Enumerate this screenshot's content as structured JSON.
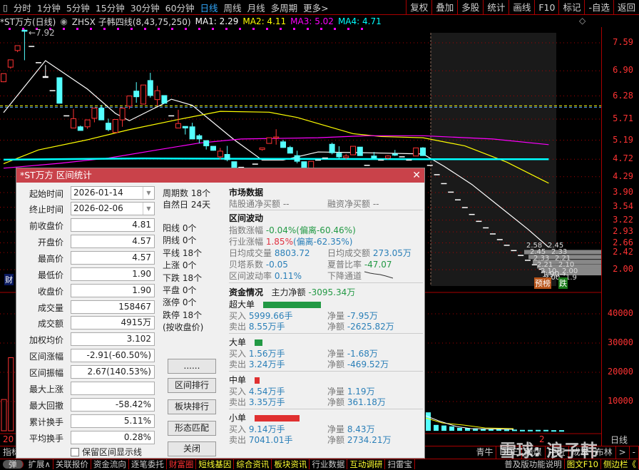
{
  "toolbar": {
    "periods": [
      "分时",
      "1分钟",
      "5分钟",
      "15分钟",
      "30分钟",
      "60分钟",
      "日线",
      "周线",
      "月线",
      "多周期",
      "更多>"
    ],
    "active": "日线",
    "right_buttons": [
      "复权",
      "叠加",
      "多股",
      "统计",
      "画线",
      "F10",
      "标记",
      "-自选",
      "返回"
    ]
  },
  "legend": {
    "title": "*ST万方(日线)",
    "indicator": "ZHSX 子韩四线(8,43,75,250)",
    "ma1": "MA1: 2.29",
    "ma2": "MA2: 4.11",
    "ma3": "MA3: 5.02",
    "ma4": "MA4: 4.71",
    "colors": {
      "ma1": "#ffffff",
      "ma2": "#ffff00",
      "ma3": "#ff00ff",
      "ma4": "#00ffff"
    }
  },
  "chart_data": {
    "type": "candlestick",
    "price_ticks": [
      "7.59",
      "6.90",
      "6.28",
      "5.71",
      "5.19",
      "4.72",
      "4.29",
      "3.90",
      "3.54",
      "3.22",
      "2.93",
      "2.66",
      "2.42",
      "2.00"
    ],
    "high_label": "7.92",
    "low_label": "1.90",
    "candles": [
      [
        6.63,
        6.83,
        6.62,
        6.83
      ],
      [
        6.99,
        7.17,
        6.95,
        7.17
      ],
      [
        7.4,
        7.52,
        7.36,
        7.52
      ],
      [
        7.9,
        7.92,
        7.16,
        7.88
      ],
      [
        7.5,
        7.5,
        7.5,
        7.5
      ],
      [
        7.1,
        7.1,
        7.1,
        7.1
      ],
      [
        6.76,
        7.04,
        6.76,
        6.76
      ],
      [
        6.41,
        6.41,
        6.41,
        6.41
      ],
      [
        6.73,
        6.73,
        6.1,
        6.1
      ],
      [
        5.79,
        5.79,
        5.79,
        5.79
      ],
      [
        5.49,
        5.96,
        5.49,
        5.72
      ],
      [
        5.52,
        5.55,
        5.43,
        5.43
      ],
      [
        5.52,
        5.69,
        5.47,
        5.69
      ],
      [
        5.73,
        5.98,
        5.63,
        5.98
      ],
      [
        5.98,
        6.06,
        5.69,
        5.69
      ],
      [
        5.61,
        5.72,
        5.41,
        5.45
      ],
      [
        5.38,
        5.7,
        5.38,
        5.7
      ],
      [
        5.69,
        5.98,
        5.52,
        5.98
      ],
      [
        6.03,
        6.28,
        5.96,
        6.28
      ],
      [
        6.4,
        6.62,
        6.11,
        6.26
      ],
      [
        6.08,
        6.55,
        6.08,
        6.55
      ],
      [
        6.66,
        6.85,
        6.24,
        6.29
      ],
      [
        6.19,
        6.53,
        6.04,
        6.41
      ],
      [
        6.29,
        6.29,
        6.1,
        6.1
      ],
      [
        5.79,
        5.79,
        5.79,
        5.79
      ],
      [
        5.49,
        5.94,
        5.49,
        5.6
      ],
      [
        5.53,
        5.53,
        5.33,
        5.49
      ],
      [
        5.52,
        5.62,
        5.22,
        5.22
      ],
      [
        5.3,
        5.34,
        5.11,
        5.22
      ],
      [
        5.18,
        5.18,
        4.96,
        5.05
      ],
      [
        5.04,
        5.04,
        4.93,
        4.94
      ],
      [
        4.78,
        5.0,
        4.71,
        4.92
      ],
      [
        4.84,
        5.05,
        4.67,
        4.71
      ],
      [
        4.66,
        4.66,
        4.46,
        4.46
      ],
      [
        4.52,
        4.52,
        4.52,
        4.52
      ],
      [
        4.45,
        4.45,
        4.45,
        4.45
      ],
      [
        4.6,
        4.6,
        4.6,
        4.6
      ],
      [
        4.96,
        5.0,
        4.93,
        5.0
      ],
      [
        5.11,
        5.25,
        5.11,
        5.25
      ],
      [
        5.26,
        5.46,
        5.08,
        5.27
      ],
      [
        5.15,
        5.2,
        5.0,
        5.01
      ],
      [
        5.01,
        5.05,
        4.87,
        4.87
      ],
      [
        4.81,
        4.93,
        4.62,
        4.67
      ],
      [
        4.66,
        4.66,
        4.52,
        4.52
      ],
      [
        4.46,
        4.67,
        4.46,
        4.67
      ],
      [
        4.7,
        4.7,
        4.7,
        4.7
      ],
      [
        4.75,
        4.75,
        4.75,
        4.75
      ],
      [
        5.09,
        5.13,
        4.84,
        4.88
      ],
      [
        4.87,
        5.04,
        4.74,
        4.78
      ],
      [
        4.76,
        4.85,
        4.72,
        4.8
      ],
      [
        4.83,
        5.04,
        4.83,
        5.04
      ],
      [
        5.02,
        5.02,
        4.81,
        4.81
      ],
      [
        4.57,
        4.57,
        4.57,
        4.57
      ],
      [
        4.8,
        4.9,
        4.75,
        4.75
      ],
      [
        4.7,
        4.7,
        4.7,
        4.7
      ],
      [
        4.75,
        4.82,
        4.72,
        4.8
      ],
      [
        4.85,
        4.95,
        4.8,
        4.82
      ],
      [
        4.78,
        4.78,
        4.78,
        4.78
      ],
      [
        4.7,
        4.7,
        4.7,
        4.7
      ],
      [
        4.8,
        5.0,
        4.8,
        5.0
      ],
      [
        5.0,
        5.02,
        4.81,
        4.81
      ]
    ],
    "projection": [
      4.57,
      4.34,
      4.12,
      3.91,
      3.72,
      3.53,
      3.36,
      3.19,
      3.03,
      2.88,
      2.74,
      2.6,
      2.47,
      2.35,
      2.23,
      2.12,
      2.01,
      1.9
    ],
    "projection_labels": [
      "2.58",
      "2.45",
      "2.45",
      "2.33",
      "2.33",
      "2.21",
      "2.21",
      "2.10",
      "2.10",
      "2.00",
      "2.00",
      "1.9"
    ],
    "ma_series": [
      {
        "name": "MA1",
        "color": "#ffffff",
        "points": [
          [
            0,
            5.87
          ],
          [
            6,
            7.15
          ],
          [
            12,
            6.45
          ],
          [
            16,
            5.85
          ],
          [
            18,
            5.67
          ],
          [
            23,
            6.1
          ],
          [
            24,
            6.2
          ],
          [
            27,
            6.05
          ],
          [
            33,
            5.2
          ],
          [
            37,
            4.7
          ],
          [
            40,
            4.7
          ],
          [
            45,
            4.9
          ],
          [
            52,
            4.88
          ],
          [
            60,
            4.85
          ],
          [
            63,
            4.55
          ],
          [
            67,
            4.1
          ],
          [
            71,
            3.55
          ],
          [
            75,
            3.0
          ],
          [
            78,
            2.55
          ]
        ]
      },
      {
        "name": "MA2",
        "color": "#ffff00",
        "points": [
          [
            0,
            4.61
          ],
          [
            5,
            4.95
          ],
          [
            12,
            5.2
          ],
          [
            18,
            5.45
          ],
          [
            25,
            5.7
          ],
          [
            31,
            5.9
          ],
          [
            38,
            5.88
          ],
          [
            42,
            5.75
          ],
          [
            46,
            5.55
          ],
          [
            50,
            5.35
          ],
          [
            54,
            5.28
          ],
          [
            60,
            5.25
          ],
          [
            66,
            5.05
          ],
          [
            72,
            4.65
          ],
          [
            78,
            4.13
          ]
        ]
      },
      {
        "name": "MA3",
        "color": "#ff00ff",
        "points": [
          [
            0,
            4.5
          ],
          [
            8,
            4.62
          ],
          [
            15,
            4.75
          ],
          [
            22,
            4.95
          ],
          [
            28,
            5.12
          ],
          [
            34,
            5.22
          ],
          [
            45,
            5.25
          ],
          [
            52,
            5.3
          ],
          [
            60,
            5.3
          ],
          [
            70,
            5.22
          ],
          [
            78,
            5.08
          ]
        ]
      },
      {
        "name": "MA4",
        "color": "#00ffff",
        "points": [
          [
            0,
            4.71
          ],
          [
            20,
            4.74
          ],
          [
            40,
            4.73
          ],
          [
            60,
            4.72
          ],
          [
            78,
            4.72
          ]
        ]
      }
    ],
    "ref_line": 6.02,
    "volume_ticks": [
      "40000",
      "30000",
      "20000",
      "10000"
    ],
    "volumes": [
      [
        0,
        10700
      ],
      [
        1,
        25000
      ]
    ],
    "volume_tail": [
      6300,
      2000,
      1800,
      1500,
      1000,
      900,
      800,
      700,
      600,
      500,
      400,
      400,
      300,
      300,
      300,
      300,
      200,
      200
    ]
  },
  "badges": {
    "forecast": "预榜",
    "limit_down": "跌",
    "left_tag": "财"
  },
  "axis": {
    "date_left": "20",
    "date_mid": "2",
    "period": "日线"
  },
  "dialog": {
    "title": "*ST万方 区间统计",
    "start_label": "起始时间",
    "start_value": "2026-01-14",
    "end_label": "终止时间",
    "end_value": "2026-02-06",
    "fields": [
      {
        "label": "前收盘价",
        "value": "4.81"
      },
      {
        "label": "开盘价",
        "value": "4.57"
      },
      {
        "label": "最高价",
        "value": "4.57"
      },
      {
        "label": "最低价",
        "value": "1.90"
      },
      {
        "label": "收盘价",
        "value": "1.90"
      },
      {
        "label": "成交量",
        "value": "158467"
      },
      {
        "label": "成交额",
        "value": "4915万"
      },
      {
        "label": "加权均价",
        "value": "3.102"
      },
      {
        "label": "区间涨幅",
        "value": "-2.91(-60.50%)"
      },
      {
        "label": "区间振幅",
        "value": "2.67(140.53%)"
      },
      {
        "label": "最大上涨",
        "value": ""
      },
      {
        "label": "最大回撤",
        "value": "-58.42%"
      },
      {
        "label": "累计换手",
        "value": "5.11%"
      },
      {
        "label": "平均换手",
        "value": "0.28%"
      }
    ],
    "keep_lines": "保留区间显示线",
    "mid": {
      "periods": "周期数 18个",
      "days": "自然日 24天",
      "stats": [
        "阳线 0个",
        "阴线 0个",
        "平线 18个",
        "上涨 0个",
        "下跌 18个",
        "平盘 0个",
        "涨停 0个",
        "跌停 18个",
        "(按收盘价)"
      ]
    },
    "buttons": [
      "......",
      "区间排行",
      "板块排行",
      "形态匹配",
      "关闭"
    ],
    "market": {
      "title": "市场数据",
      "hk_label": "陆股通净买额",
      "hk_value": "--",
      "margin_label": "融资净买额",
      "margin_value": "--"
    },
    "volatility": {
      "title": "区间波动",
      "index_label": "指数涨幅",
      "index_value": "-0.04%(偏离-60.46%)",
      "industry_label": "行业涨幅",
      "industry_value": "1.85%",
      "industry_dev": "(偏离-62.35%)",
      "avg_vol_label": "日均成交量",
      "avg_vol": "8803.72",
      "avg_amt_label": "日均成交额",
      "avg_amt": "273.05万",
      "beta_label": "贝塔系数",
      "beta": "-0.05",
      "sharpe_label": "夏普比率",
      "sharpe": "-47.07",
      "vol_label": "区间波动率",
      "vol": "0.11%",
      "channel": "下降通道"
    },
    "funds": {
      "title": "资金情况",
      "main_label": "主力净额",
      "main_value": "-3095.34万",
      "groups": [
        {
          "name": "超大单",
          "color": "#229944",
          "bar": 0.45,
          "buy": "5999.66手",
          "sell": "8.55万手",
          "net_vol": "-7.95万",
          "net_amt": "-2625.82万"
        },
        {
          "name": "大单",
          "color": "#229944",
          "bar": 0.06,
          "buy": "1.56万手",
          "sell": "3.24万手",
          "net_vol": "-1.68万",
          "net_amt": "-469.52万"
        },
        {
          "name": "中单",
          "color": "#e03030",
          "bar": 0.04,
          "buy": "4.54万手",
          "sell": "3.35万手",
          "net_vol": "1.19万",
          "net_amt": "361.18万"
        },
        {
          "name": "小单",
          "color": "#e03030",
          "bar": 0.35,
          "buy": "9.14万手",
          "sell": "7041.01手",
          "net_vol": "8.43万",
          "net_amt": "2734.21万"
        }
      ],
      "buy_label": "买入",
      "sell_label": "卖出",
      "net_vol_label": "净量",
      "net_amt_label": "净额"
    }
  },
  "tabrow": [
    "指标",
    "135",
    "青牛",
    "DDE",
    "阳煤",
    "中班",
    "成本",
    "布林",
    ">",
    "-"
  ],
  "bottombar": {
    "items": [
      {
        "t": "扩展∧",
        "c": "#ccc"
      },
      {
        "t": "关联报价",
        "c": "#ccc"
      },
      {
        "t": "资金流向",
        "c": "#ccc"
      },
      {
        "t": "逐笔委托",
        "c": "#ccc"
      },
      {
        "t": "财富圈",
        "c": "#ff3030"
      },
      {
        "t": "短线基因",
        "c": "#ffff30"
      },
      {
        "t": "综合资讯",
        "c": "#ffff30"
      },
      {
        "t": "板块资讯",
        "c": "#ffff30"
      },
      {
        "t": "行业数据",
        "c": "#ccc"
      },
      {
        "t": "互动调研",
        "c": "#ffff30"
      },
      {
        "t": "扫雷宝",
        "c": "#ccc"
      }
    ],
    "right": [
      {
        "t": "普及版功能说明",
        "c": "#ccc"
      },
      {
        "t": "图文F10",
        "c": "#ffff30"
      },
      {
        "t": "侧边栏《",
        "c": "#ffff30"
      }
    ],
    "toggle": "弹"
  },
  "watermark": "雪球: 浪子韩"
}
